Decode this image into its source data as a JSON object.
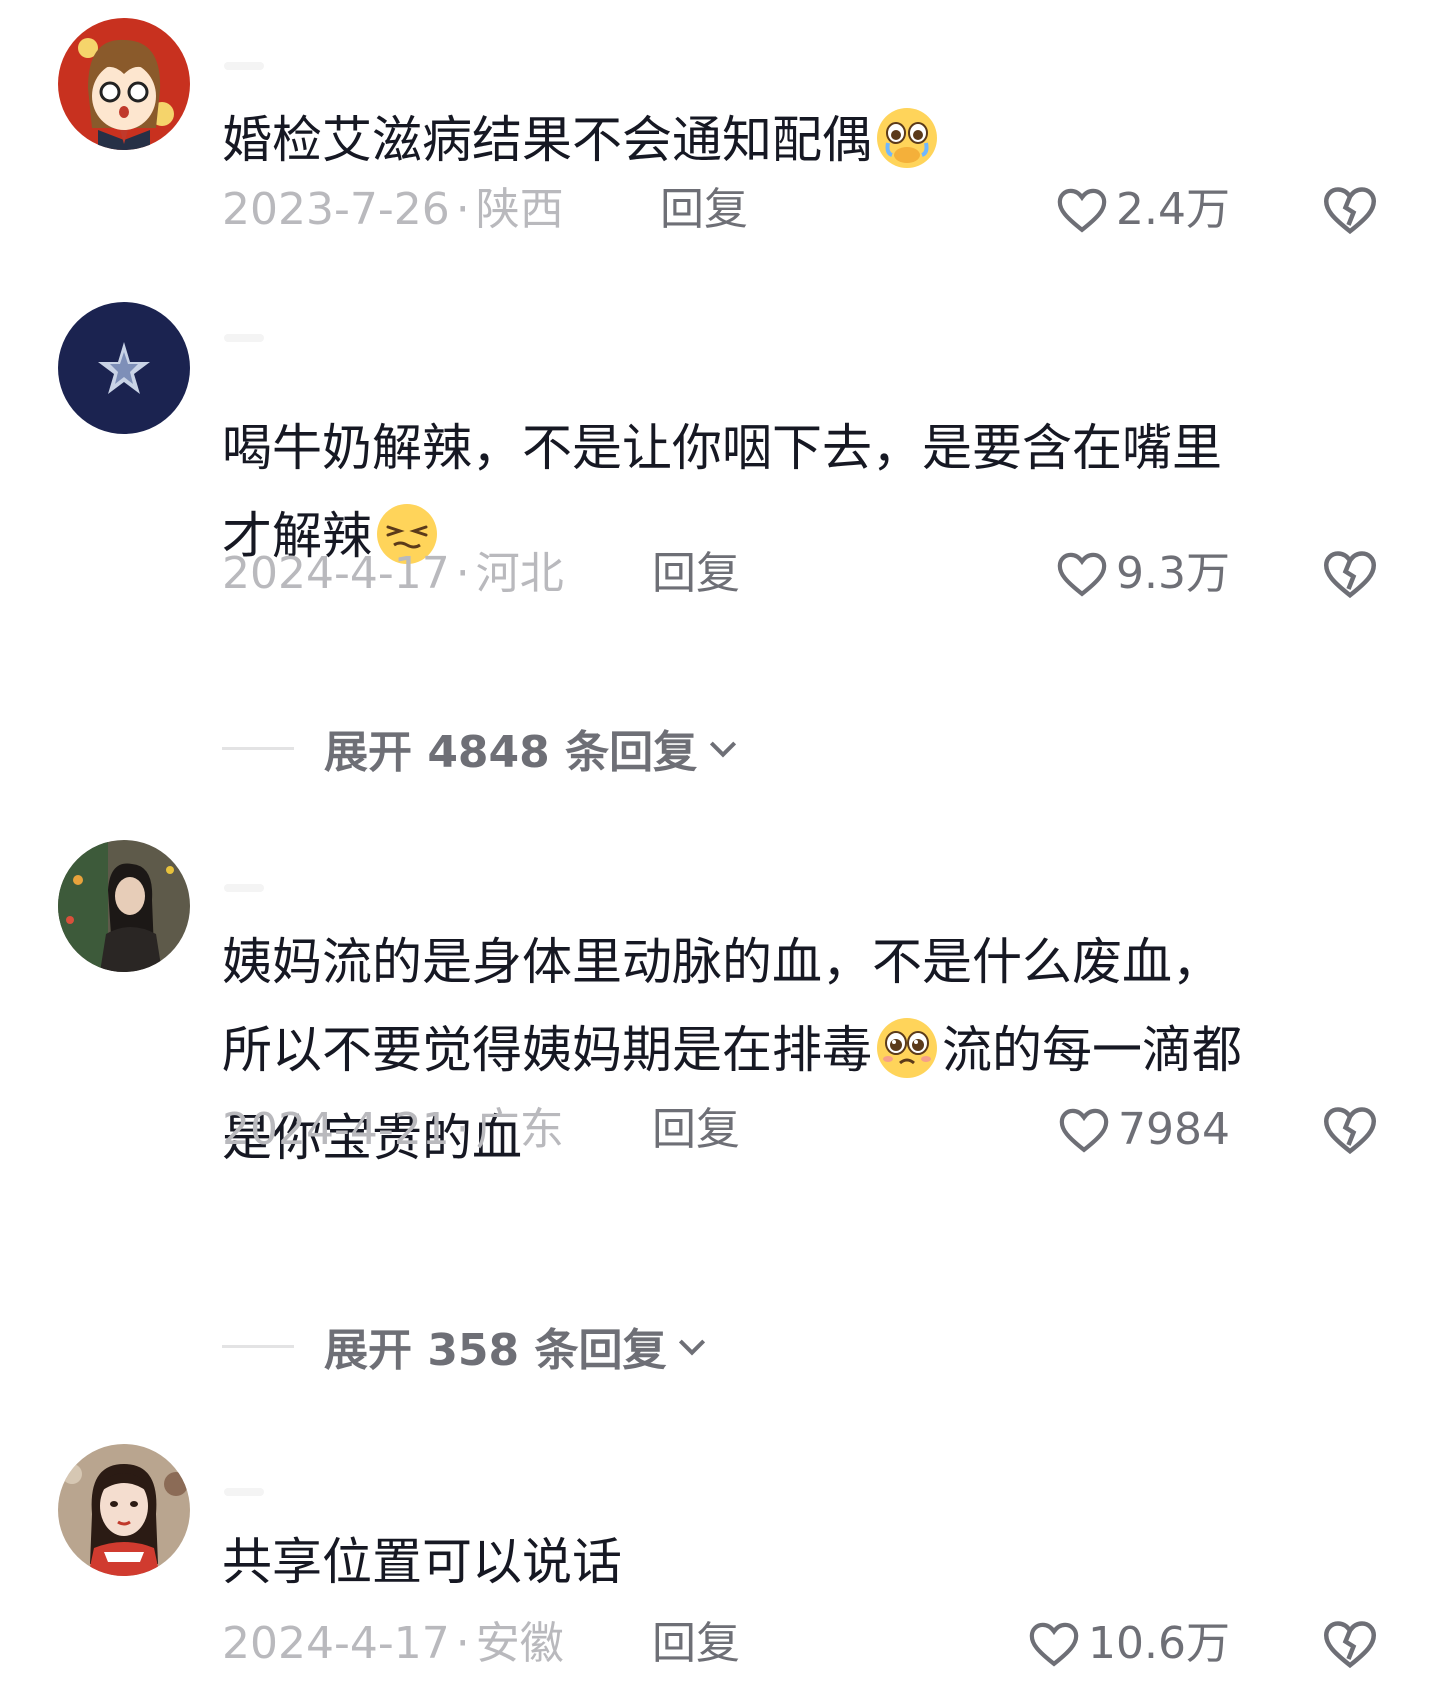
{
  "comments": [
    {
      "text_parts": [
        "婚检艾滋病结果不会通知配偶"
      ],
      "text_after": "",
      "emoji": "crying-face-icon",
      "date": "2023-7-26",
      "location": "陕西",
      "reply_label": "回复",
      "likes": "2.4万"
    },
    {
      "text_line1": "喝牛奶解辣，不是让你咽下去，是要含在嘴里",
      "text_line2": "才解辣",
      "emoji": "smirk-face-icon",
      "date": "2024-4-17",
      "location": "河北",
      "reply_label": "回复",
      "likes": "9.3万",
      "expand_label": "展开 4848 条回复"
    },
    {
      "text_line1": "姨妈流的是身体里动脉的血，不是什么废血，",
      "text_line2_before": "所以不要觉得姨妈期是在排毒",
      "text_line2_after": "流的每一滴都",
      "text_line3": "是你宝贵的血",
      "emoji": "pleading-face-icon",
      "date": "2024-4-21",
      "location": "广东",
      "reply_label": "回复",
      "likes": "7984",
      "expand_label": "展开 358 条回复"
    },
    {
      "text": "共享位置可以说话",
      "date": "2024-4-17",
      "location": "安徽",
      "reply_label": "回复",
      "likes": "10.6万"
    }
  ],
  "meta_separator": "·",
  "colors": {
    "text": "#161823",
    "meta": "#b9b9bd",
    "action": "#6e6f76",
    "emoji_yellow": "#ffd45a"
  }
}
